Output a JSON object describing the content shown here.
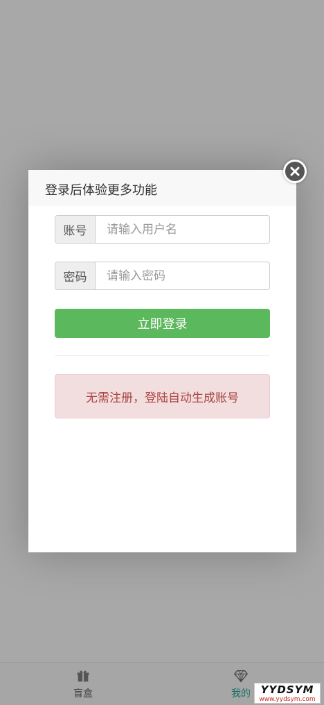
{
  "modal": {
    "title": "登录后体验更多功能",
    "username": {
      "addon": "账号",
      "placeholder": "请输入用户名"
    },
    "password": {
      "addon": "密码",
      "placeholder": "请输入密码"
    },
    "login_label": "立即登录",
    "notice": "无需注册，登陆自动生成账号"
  },
  "tabbar": {
    "items": [
      {
        "label": "盲盒",
        "icon": "gift-icon"
      },
      {
        "label": "我的",
        "icon": "diamond-icon",
        "active": true
      }
    ]
  },
  "watermark": {
    "line1": "YYDSYM",
    "line2": "www.yydsym.com"
  },
  "colors": {
    "primary": "#5cb85c",
    "danger_bg": "#f2dede",
    "danger_text": "#a94442",
    "active_tab": "#1a6f66"
  }
}
